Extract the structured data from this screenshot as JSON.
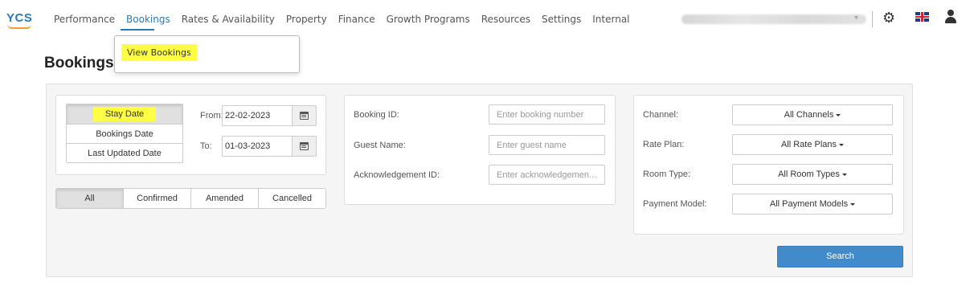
{
  "brand": {
    "logo_text": "YCS"
  },
  "nav": {
    "items": [
      {
        "label": "Performance",
        "active": false
      },
      {
        "label": "Bookings",
        "active": true
      },
      {
        "label": "Rates & Availability",
        "active": false
      },
      {
        "label": "Property",
        "active": false
      },
      {
        "label": "Finance",
        "active": false
      },
      {
        "label": "Growth Programs",
        "active": false
      },
      {
        "label": "Resources",
        "active": false
      },
      {
        "label": "Settings",
        "active": false
      },
      {
        "label": "Internal",
        "active": false
      }
    ],
    "user_caret": "▾",
    "gear_glyph": "⚙"
  },
  "dropdown": {
    "view_bookings": "View Bookings"
  },
  "page": {
    "title": "Bookings"
  },
  "date_panel": {
    "types": [
      "Stay Date",
      "Bookings Date",
      "Last Updated Date"
    ],
    "selected_type": "Stay Date",
    "from_label": "From:",
    "from_value": "22-02-2023",
    "to_label": "To:",
    "to_value": "01-03-2023"
  },
  "status_tabs": {
    "items": [
      "All",
      "Confirmed",
      "Amended",
      "Cancelled"
    ],
    "selected": "All"
  },
  "id_panel": {
    "booking_id_label": "Booking ID:",
    "booking_id_placeholder": "Enter booking number",
    "guest_name_label": "Guest Name:",
    "guest_name_placeholder": "Enter guest name",
    "ack_id_label": "Acknowledgement ID:",
    "ack_id_placeholder": "Enter acknowledgemen..."
  },
  "filter_panel": {
    "channel_label": "Channel:",
    "channel_value": "All Channels",
    "rate_plan_label": "Rate Plan:",
    "rate_plan_value": "All Rate Plans",
    "room_type_label": "Room Type:",
    "room_type_value": "All Room Types",
    "payment_model_label": "Payment Model:",
    "payment_model_value": "All Payment Models"
  },
  "actions": {
    "search_label": "Search"
  },
  "colors": {
    "accent": "#2a7ab8",
    "primary_button": "#428bca",
    "highlight": "#ffff44"
  }
}
